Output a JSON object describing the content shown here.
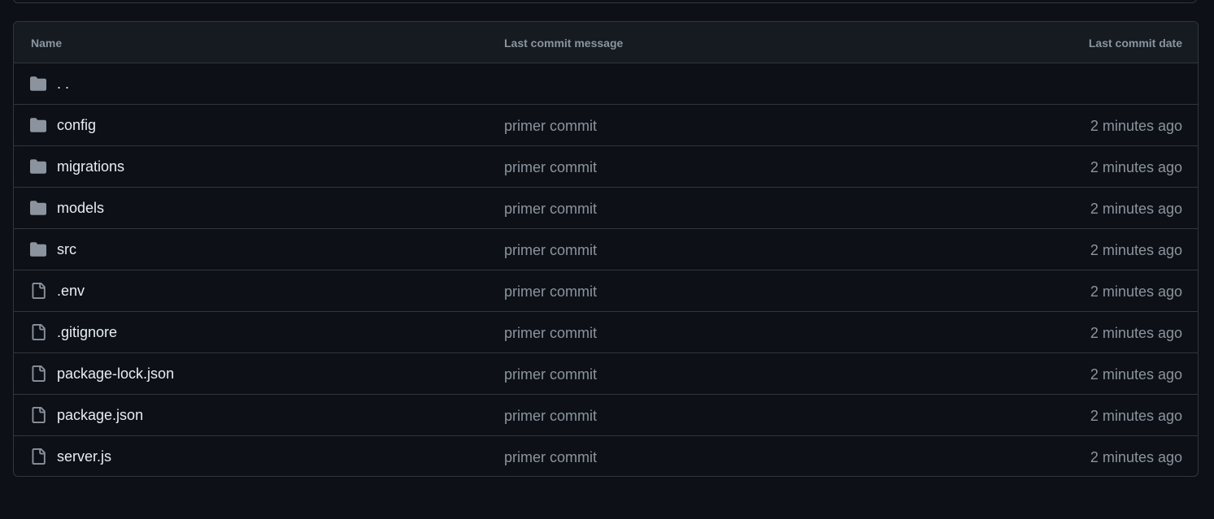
{
  "table": {
    "headers": {
      "name": "Name",
      "message": "Last commit message",
      "date": "Last commit date"
    },
    "parent": {
      "name": ". .",
      "icon": "folder-icon"
    },
    "rows": [
      {
        "name": "config",
        "icon": "folder-icon",
        "message": "primer commit",
        "date": "2 minutes ago"
      },
      {
        "name": "migrations",
        "icon": "folder-icon",
        "message": "primer commit",
        "date": "2 minutes ago"
      },
      {
        "name": "models",
        "icon": "folder-icon",
        "message": "primer commit",
        "date": "2 minutes ago"
      },
      {
        "name": "src",
        "icon": "folder-icon",
        "message": "primer commit",
        "date": "2 minutes ago"
      },
      {
        "name": ".env",
        "icon": "file-icon",
        "message": "primer commit",
        "date": "2 minutes ago"
      },
      {
        "name": ".gitignore",
        "icon": "file-icon",
        "message": "primer commit",
        "date": "2 minutes ago"
      },
      {
        "name": "package-lock.json",
        "icon": "file-icon",
        "message": "primer commit",
        "date": "2 minutes ago"
      },
      {
        "name": "package.json",
        "icon": "file-icon",
        "message": "primer commit",
        "date": "2 minutes ago"
      },
      {
        "name": "server.js",
        "icon": "file-icon",
        "message": "primer commit",
        "date": "2 minutes ago"
      }
    ]
  },
  "colors": {
    "background": "#0d1117",
    "header_bg": "#161b22",
    "border": "#30363d",
    "text_primary": "#e6edf3",
    "text_muted": "#8b949e",
    "icon": "#8b949e"
  }
}
